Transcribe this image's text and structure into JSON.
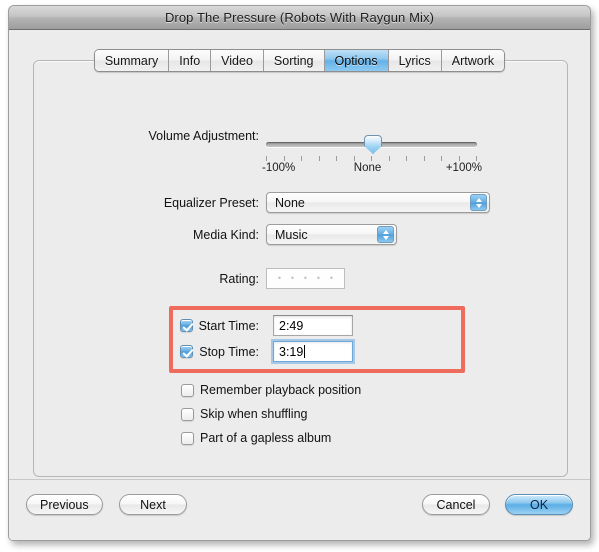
{
  "window": {
    "title": "Drop The Pressure (Robots With Raygun Mix)"
  },
  "tabs": [
    {
      "label": "Summary",
      "active": false
    },
    {
      "label": "Info",
      "active": false
    },
    {
      "label": "Video",
      "active": false
    },
    {
      "label": "Sorting",
      "active": false
    },
    {
      "label": "Options",
      "active": true
    },
    {
      "label": "Lyrics",
      "active": false
    },
    {
      "label": "Artwork",
      "active": false
    }
  ],
  "form": {
    "volume": {
      "label": "Volume Adjustment:",
      "min_label": "-100%",
      "mid_label": "None",
      "max_label": "+100%",
      "value": 0,
      "tick_count": 13
    },
    "equalizer": {
      "label": "Equalizer Preset:",
      "value": "None"
    },
    "media_kind": {
      "label": "Media Kind:",
      "value": "Music"
    },
    "rating": {
      "label": "Rating:",
      "stars": 0,
      "star_slots": [
        "•",
        "•",
        "•",
        "•",
        "•"
      ]
    },
    "start_time": {
      "label": "Start Time:",
      "checked": true,
      "value": "2:49"
    },
    "stop_time": {
      "label": "Stop Time:",
      "checked": true,
      "value": "3:19",
      "focused": true
    },
    "checkboxes": [
      {
        "label": "Remember playback position",
        "checked": false
      },
      {
        "label": "Skip when shuffling",
        "checked": false
      },
      {
        "label": "Part of a gapless album",
        "checked": false
      }
    ]
  },
  "buttons": {
    "previous": "Previous",
    "next": "Next",
    "cancel": "Cancel",
    "ok": "OK"
  },
  "colors": {
    "highlight": "#ef6b5c",
    "accent_blue": "#63b2e9",
    "window_bg": "#ececec"
  }
}
